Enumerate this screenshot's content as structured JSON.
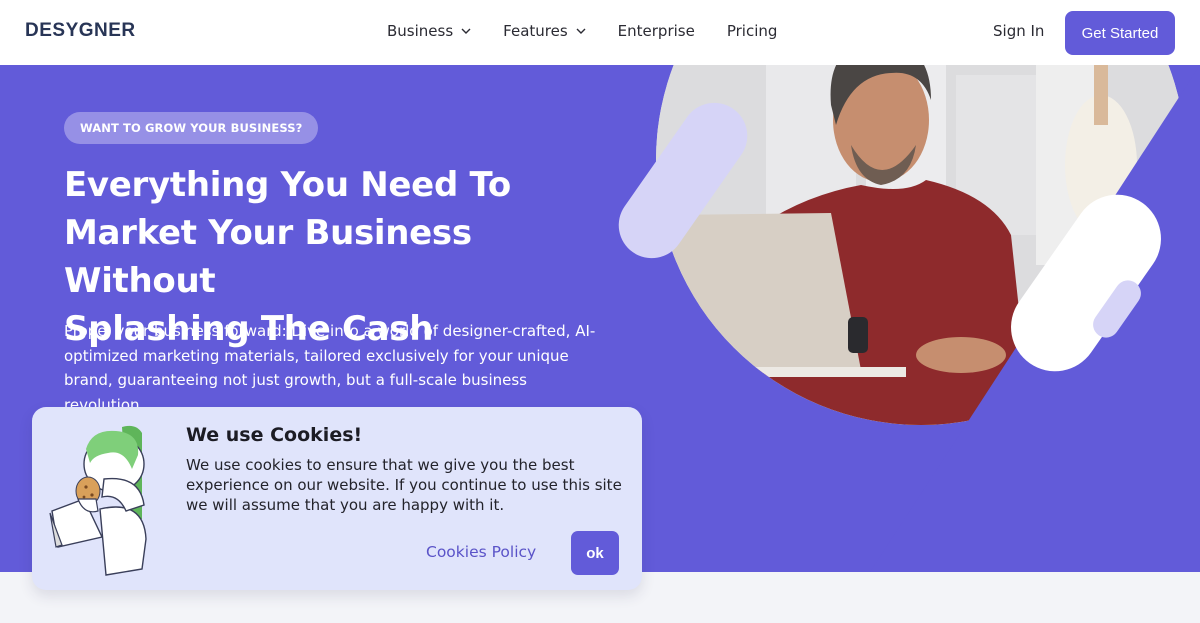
{
  "header": {
    "logo": "DESYGNER",
    "nav": [
      {
        "label": "Business",
        "has_dropdown": true
      },
      {
        "label": "Features",
        "has_dropdown": true
      },
      {
        "label": "Enterprise",
        "has_dropdown": false
      },
      {
        "label": "Pricing",
        "has_dropdown": false
      }
    ],
    "sign_in": "Sign In",
    "cta": "Get Started"
  },
  "hero": {
    "badge": "WANT TO GROW YOUR BUSINESS?",
    "title_lines": [
      "Everything You Need To",
      "Market Your Business Without",
      "Splashing The Cash"
    ],
    "description": "Propel your business forward: Dive into a world of designer-crafted, AI-optimized marketing materials, tailored exclusively for your unique brand, guaranteeing not just growth, but a full-scale business revolution.",
    "image_alt": "Smiling man in red t-shirt working on a laptop"
  },
  "cookie_banner": {
    "title": "We use Cookies!",
    "text": "We use cookies to ensure that we give you the best experience on our website. If you continue to use this site we will assume that you are happy with it.",
    "policy_link": "Cookies Policy",
    "ok_button": "ok"
  },
  "colors": {
    "brand": "#625bd9",
    "logo": "#283556",
    "banner_bg": "#e0e4fb",
    "pill_light": "#d6d4f7"
  }
}
